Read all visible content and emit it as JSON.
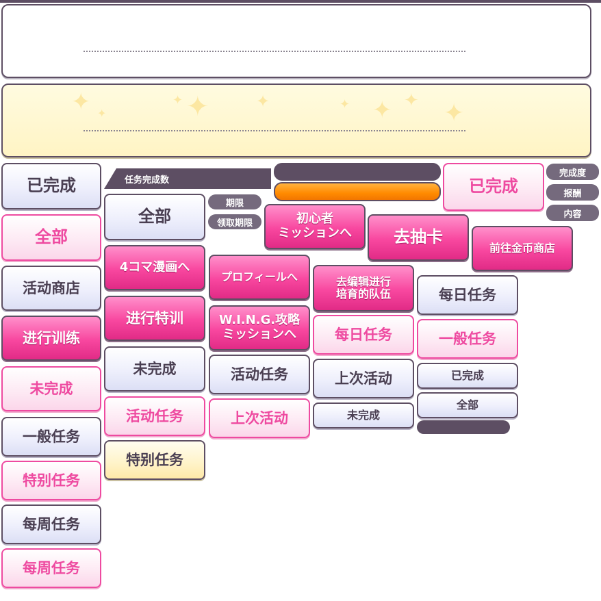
{
  "status_tags": {
    "completion_rate": "完成度",
    "reward": "报酬",
    "content": "内容",
    "period": "期限",
    "claim_period": "领取期限"
  },
  "ribbon": {
    "mission_count": "任务完成数"
  },
  "col1": {
    "completed": "已完成",
    "all": "全部",
    "event_shop": "活动商店",
    "do_training": "进行训练",
    "incomplete": "未完成",
    "general_missions": "一般任务",
    "special_missions": "特别任务",
    "weekly_missions": "每周任务",
    "weekly_missions_active": "每周任务"
  },
  "col2": {
    "all": "全部",
    "to_4koma": "4コマ漫画へ",
    "special_training": "进行特训",
    "incomplete": "未完成",
    "event_missions": "活动任务",
    "special_missions": "特别任务"
  },
  "col3": {
    "beginner_missions": "初心者\nミッションへ",
    "to_profile": "プロフィールへ",
    "wing_missions": "W.I.N.G.攻略\nミッションへ",
    "event_missions": "活动任务",
    "last_event": "上次活动"
  },
  "col4": {
    "gacha": "去抽卡",
    "edit_team": "去编辑进行\n培育的队伍",
    "daily_missions": "每日任务",
    "last_event": "上次活动",
    "incomplete": "未完成"
  },
  "col5": {
    "completed_big": "已完成",
    "gold_shop": "前往金币商店",
    "daily_missions": "每日任务",
    "general_missions": "一般任务",
    "completed": "已完成",
    "all": "全部"
  },
  "progress": {
    "fill_fraction": 1.0
  },
  "colors": {
    "outline": "#5d4e63",
    "pink": "#ee4aa0",
    "magenta": "#f8479f",
    "orange": "#ff8a00"
  }
}
